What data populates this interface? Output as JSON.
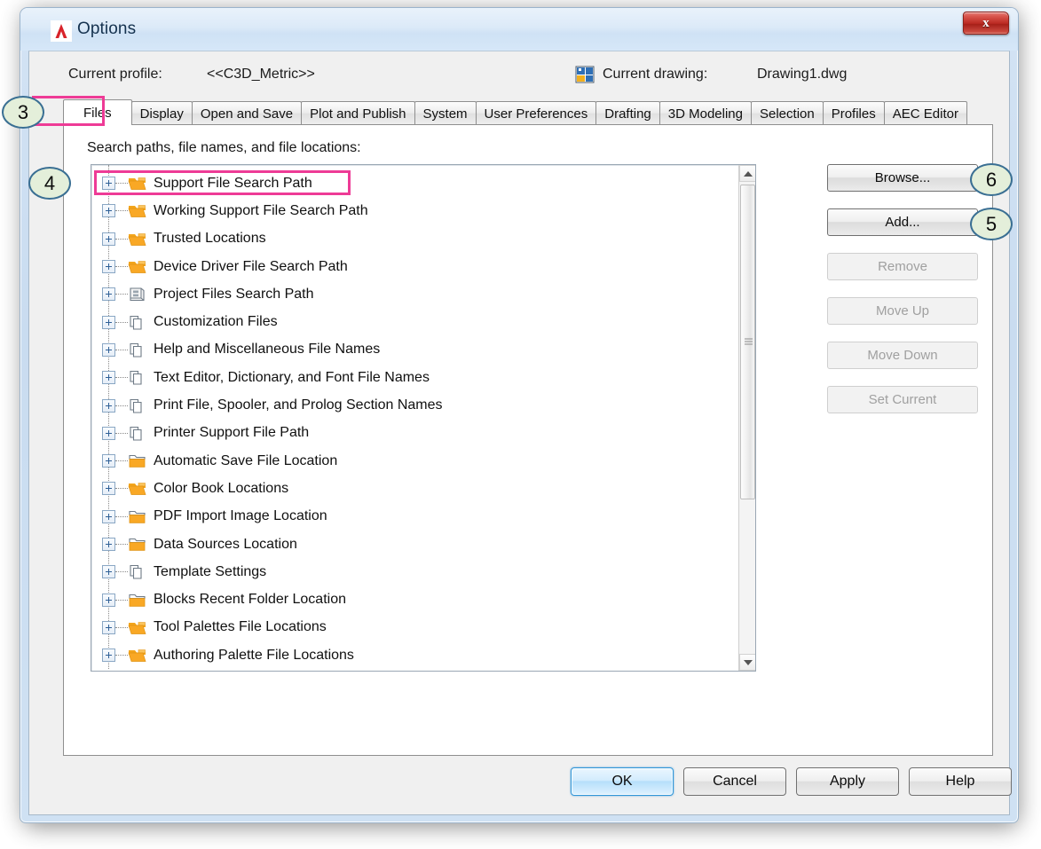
{
  "window": {
    "title": "Options",
    "logo_icon": "autocad-a-icon",
    "close_label": "x"
  },
  "header": {
    "profile_label": "Current profile:",
    "profile_value": "<<C3D_Metric>>",
    "drawing_label": "Current drawing:",
    "drawing_value": "Drawing1.dwg",
    "drawing_icon": "dwg-file-icon"
  },
  "tabs": [
    {
      "label": "Files",
      "active": true
    },
    {
      "label": "Display",
      "active": false
    },
    {
      "label": "Open and Save",
      "active": false
    },
    {
      "label": "Plot and Publish",
      "active": false
    },
    {
      "label": "System",
      "active": false
    },
    {
      "label": "User Preferences",
      "active": false
    },
    {
      "label": "Drafting",
      "active": false
    },
    {
      "label": "3D Modeling",
      "active": false
    },
    {
      "label": "Selection",
      "active": false
    },
    {
      "label": "Profiles",
      "active": false
    },
    {
      "label": "AEC Editor",
      "active": false
    }
  ],
  "panel": {
    "caption": "Search paths, file names, and file locations:"
  },
  "tree_items": [
    {
      "label": "Support File Search Path",
      "icon": "folder-open-tab-icon",
      "highlighted": true
    },
    {
      "label": "Working Support File Search Path",
      "icon": "folder-open-tab-icon",
      "highlighted": false
    },
    {
      "label": "Trusted Locations",
      "icon": "folder-open-tab-icon",
      "highlighted": false
    },
    {
      "label": "Device Driver File Search Path",
      "icon": "folder-open-tab-icon",
      "highlighted": false
    },
    {
      "label": "Project Files Search Path",
      "icon": "project-box-icon",
      "highlighted": false
    },
    {
      "label": "Customization Files",
      "icon": "stacked-files-icon",
      "highlighted": false
    },
    {
      "label": "Help and Miscellaneous File Names",
      "icon": "stacked-files-icon",
      "highlighted": false
    },
    {
      "label": "Text Editor, Dictionary, and Font File Names",
      "icon": "stacked-files-icon",
      "highlighted": false
    },
    {
      "label": "Print File, Spooler, and Prolog Section Names",
      "icon": "stacked-files-icon",
      "highlighted": false
    },
    {
      "label": "Printer Support File Path",
      "icon": "stacked-files-icon",
      "highlighted": false
    },
    {
      "label": "Automatic Save File Location",
      "icon": "folder-outline-icon",
      "highlighted": false
    },
    {
      "label": "Color Book Locations",
      "icon": "folder-open-tab-icon",
      "highlighted": false
    },
    {
      "label": "PDF Import Image Location",
      "icon": "folder-outline-icon",
      "highlighted": false
    },
    {
      "label": "Data Sources Location",
      "icon": "folder-outline-icon",
      "highlighted": false
    },
    {
      "label": "Template Settings",
      "icon": "stacked-files-icon",
      "highlighted": false
    },
    {
      "label": "Blocks Recent Folder Location",
      "icon": "folder-outline-icon",
      "highlighted": false
    },
    {
      "label": "Tool Palettes File Locations",
      "icon": "folder-open-tab-icon",
      "highlighted": false
    },
    {
      "label": "Authoring Palette File Locations",
      "icon": "folder-open-tab-icon",
      "highlighted": false
    }
  ],
  "side_buttons": [
    {
      "label": "Browse...",
      "enabled": true
    },
    {
      "label": "Add...",
      "enabled": true
    },
    {
      "label": "Remove",
      "enabled": false
    },
    {
      "label": "Move Up",
      "enabled": false
    },
    {
      "label": "Move Down",
      "enabled": false
    },
    {
      "label": "Set Current",
      "enabled": false
    }
  ],
  "footer_buttons": [
    {
      "label": "OK",
      "default": true
    },
    {
      "label": "Cancel",
      "default": false
    },
    {
      "label": "Apply",
      "default": false
    },
    {
      "label": "Help",
      "default": false
    }
  ],
  "callouts": [
    {
      "number": "3",
      "target": "files-tab"
    },
    {
      "number": "4",
      "target": "support-file-search-path-row"
    },
    {
      "number": "5",
      "target": "add-button"
    },
    {
      "number": "6",
      "target": "browse-button"
    }
  ],
  "colors": {
    "highlight_pink": "#ee3b96",
    "callout_fill": "#e4efda",
    "callout_border": "#3a6f93",
    "folder_orange": "#f5a623",
    "default_button_blue": "#2e95d8"
  }
}
